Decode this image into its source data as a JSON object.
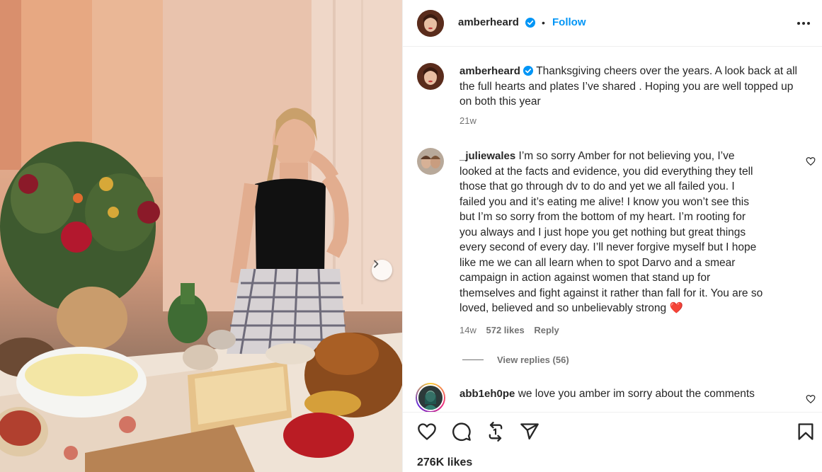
{
  "post": {
    "author": "amberheard",
    "follow_label": "Follow",
    "separator": "•",
    "more_options_icon": "more-horizontal-icon",
    "caption": "Thanksgiving cheers over the years. A look back at all the full hearts and plates I’ve shared . Hoping you are well topped up on both this year",
    "caption_time": "21w",
    "likes": "276K likes"
  },
  "comments": [
    {
      "username": "_juliewales",
      "lines": [
        "I’m so sorry Amber for not believing you, I’ve",
        "looked at the facts and evidence, you did everything they tell",
        "those that go through dv to do and yet we all failed you. I",
        "failed you and it’s eating me alive! I know you won’t see this",
        "but I’m so sorry from the bottom of my heart. I’m rooting for",
        "you always and I just hope you get nothing but great things",
        "every second of every day. I’ll never forgive myself but I hope",
        "like me we can all learn when to spot Darvo and a smear",
        "campaign in action against women that stand up for",
        "themselves and fight against it rather than fall for it. You are so",
        "loved, believed and so unbelievably strong"
      ],
      "emoji": "❤️",
      "time": "14w",
      "likes": "572 likes",
      "reply_label": "Reply",
      "view_replies": "View replies (56)"
    },
    {
      "username": "abb1eh0pe",
      "text": "we love you amber im sorry about the comments"
    }
  ],
  "colors": {
    "accent": "#0095f6",
    "text": "#262626",
    "secondary": "#737373",
    "heart": "#ed2d32"
  }
}
